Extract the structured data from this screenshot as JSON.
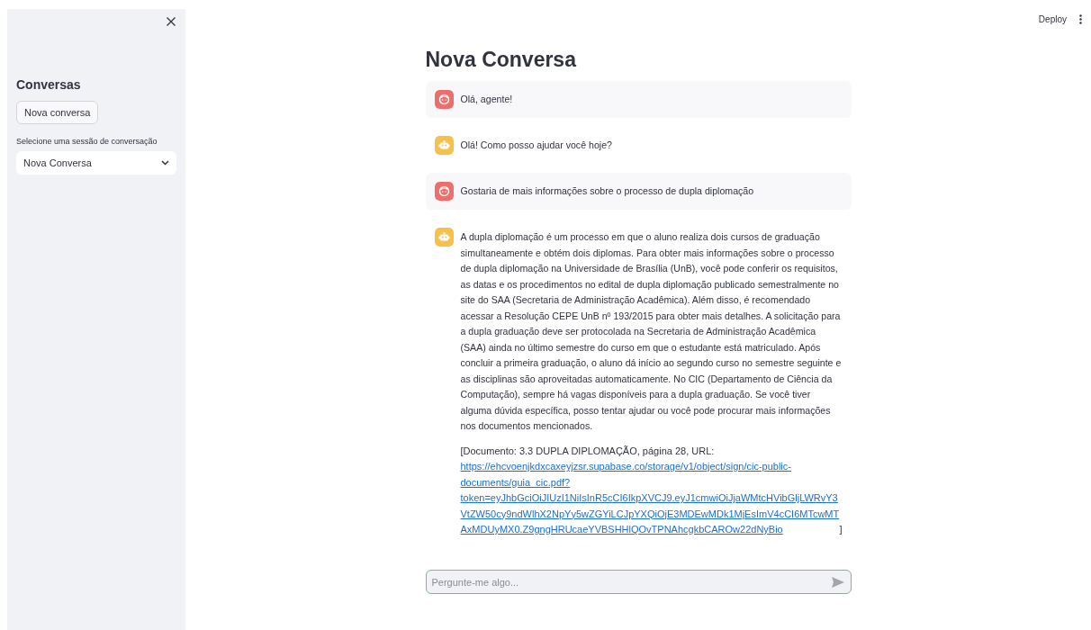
{
  "sidebar": {
    "heading": "Conversas",
    "new_button": "Nova conversa",
    "select_label": "Selecione uma sessão de conversação",
    "select_value": "Nova Conversa"
  },
  "toolbar": {
    "deploy": "Deploy"
  },
  "title": "Nova Conversa",
  "messages": [
    {
      "kind": "user",
      "text": "Olá, agente!"
    },
    {
      "kind": "assistant",
      "text": "Olá! Como posso ajudar você hoje?"
    },
    {
      "kind": "user",
      "text": "Gostaria de mais informações sobre o processo de dupla diplomação"
    },
    {
      "kind": "assistant",
      "text": "A dupla diplomação é um processo em que o aluno realiza dois cursos de graduação simultaneamente e obtém dois diplomas. Para obter mais informações sobre o processo de dupla diplomação na Universidade de Brasília (UnB), você pode conferir os requisitos, as datas e os procedimentos no edital de dupla diplomação publicado semestralmente no site do SAA (Secretaria de Administração Acadêmica). Além disso, é recomendado acessar a Resolução CEPE UnB nº 193/2015 para obter mais detalhes. A solicitação para a dupla graduação deve ser protocolada na Secretaria de Administração Acadêmica (SAA) ainda no último semestre do curso em que o estudante está matriculado. Após concluir a primeira graduação, o aluno dá início ao segundo curso no semestre seguinte e as disciplinas são aproveitadas automaticamente. No CIC (Departamento de Ciência da Computação), sempre há vagas disponíveis para a dupla graduação. Se você tiver alguma dúvida específica, posso tentar ajudar ou você pode procurar mais informações nos documentos mencionados.",
      "citation": {
        "prefix": "[Documento: 3.3 DUPLA DIPLOMAÇÃO, página 28, URL:",
        "link": "https://ehcvoenjkdxcaxeyjzsr.supabase.co/storage/v1/object/sign/cic-public-documents/guia_cic.pdf?token=eyJhbGciOiJIUzI1NiIsInR5cCI6IkpXVCJ9.eyJ1cmwiOiJjaWMtcHVibGljLWRvY3VtZW50cy9ndWlhX2NpYy5wZGYiLCJpYXQiOjE3MDEwMDk1MjEsImV4cCI6MTcwMTAxMDUyMX0.Z9gngHRUcaeYVBSHHlQOvTPNAhcgkbCAROw22dNyBio",
        "suffix": "]"
      }
    }
  ],
  "chat_input": {
    "placeholder": "Pergunte-me algo..."
  }
}
